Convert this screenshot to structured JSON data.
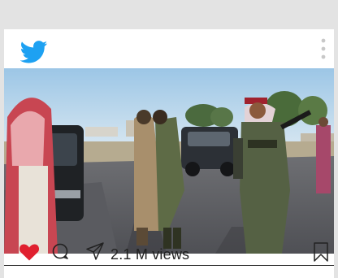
{
  "post": {
    "brand_icon": "twitter-bird-icon",
    "menu_icon": "more-vertical-icon",
    "actions": {
      "like_icon": "heart-icon",
      "like_color": "#e0202f",
      "comment_icon": "comment-bubble-icon",
      "share_icon": "send-icon",
      "bookmark_icon": "bookmark-icon",
      "views_text": "2.1  M views"
    }
  },
  "colors": {
    "twitter_blue": "#1da1f2",
    "page_background": "#e3e3e3",
    "card_background": "#ffffff"
  }
}
